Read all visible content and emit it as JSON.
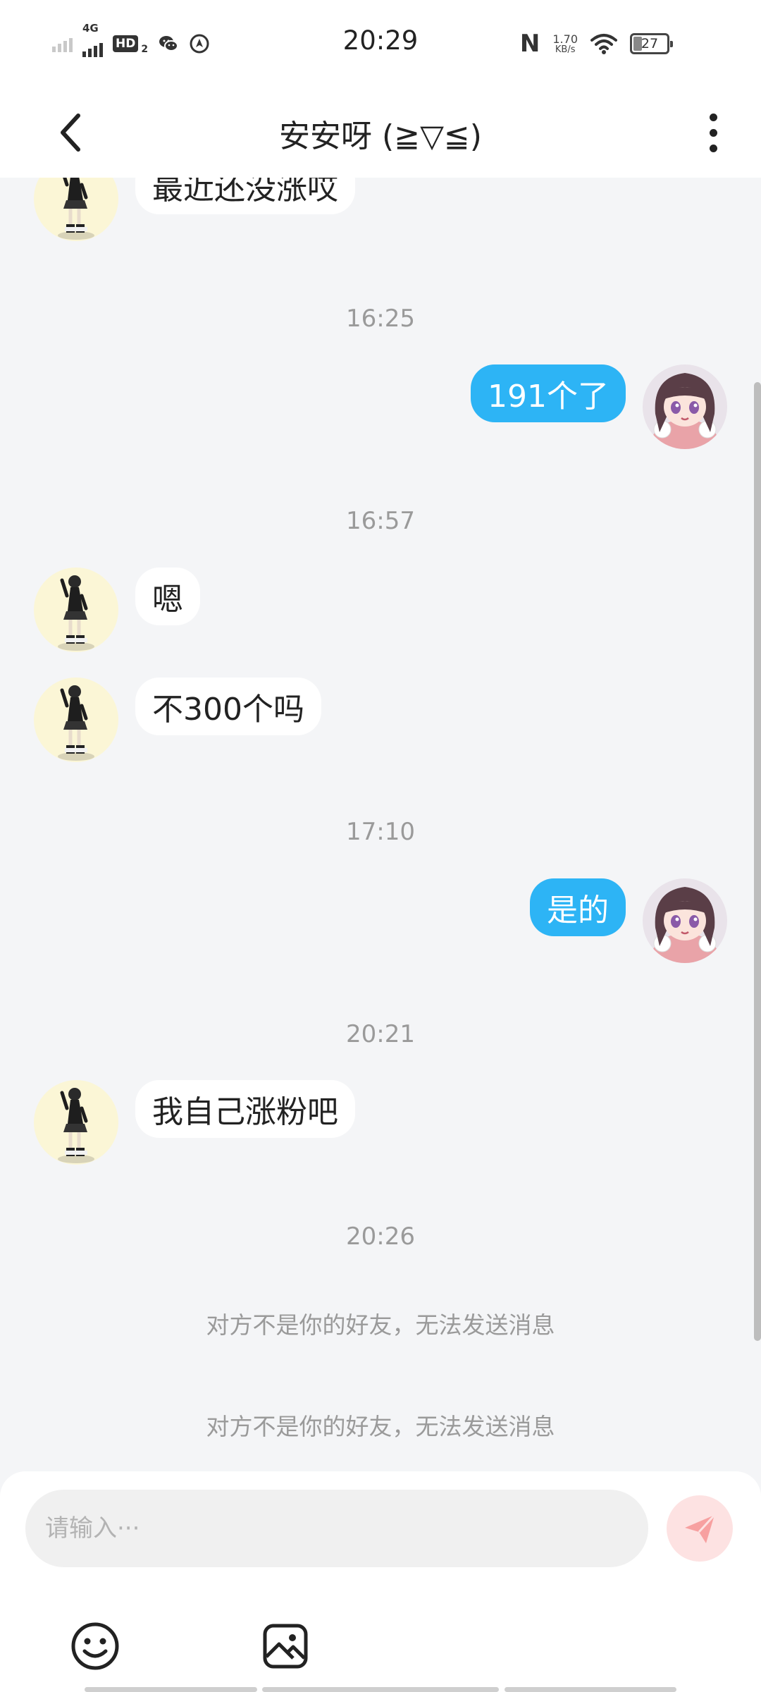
{
  "status_bar": {
    "network": "4G",
    "hd": "HD",
    "hd_sub": "2",
    "time": "20:29",
    "nfc": "N",
    "speed_value": "1.70",
    "speed_unit": "KB/s",
    "battery": "27"
  },
  "header": {
    "title": "安安呀 (≧▽≦)"
  },
  "messages": [
    {
      "from": "them",
      "text": "最近还没涨哎"
    },
    {
      "time": "16:25"
    },
    {
      "from": "me",
      "text": "191个了"
    },
    {
      "time": "16:57"
    },
    {
      "from": "them",
      "text": "嗯"
    },
    {
      "from": "them",
      "text": "不300个吗"
    },
    {
      "time": "17:10"
    },
    {
      "from": "me",
      "text": "是的"
    },
    {
      "time": "20:21"
    },
    {
      "from": "them",
      "text": "我自己涨粉吧"
    },
    {
      "time": "20:26"
    },
    {
      "system": "对方不是你的好友，无法发送消息"
    },
    {
      "system": "对方不是你的好友，无法发送消息"
    }
  ],
  "composer": {
    "placeholder": "请输入···",
    "value": ""
  },
  "colors": {
    "outgoing_bubble": "#2db4f5",
    "incoming_bubble": "#ffffff",
    "background": "#f4f5f7",
    "send_button_bg": "#fde2e2",
    "send_icon": "#f7a0a0"
  },
  "icons": [
    "back-icon",
    "more-icon",
    "send-icon",
    "emoji-icon",
    "image-icon"
  ]
}
